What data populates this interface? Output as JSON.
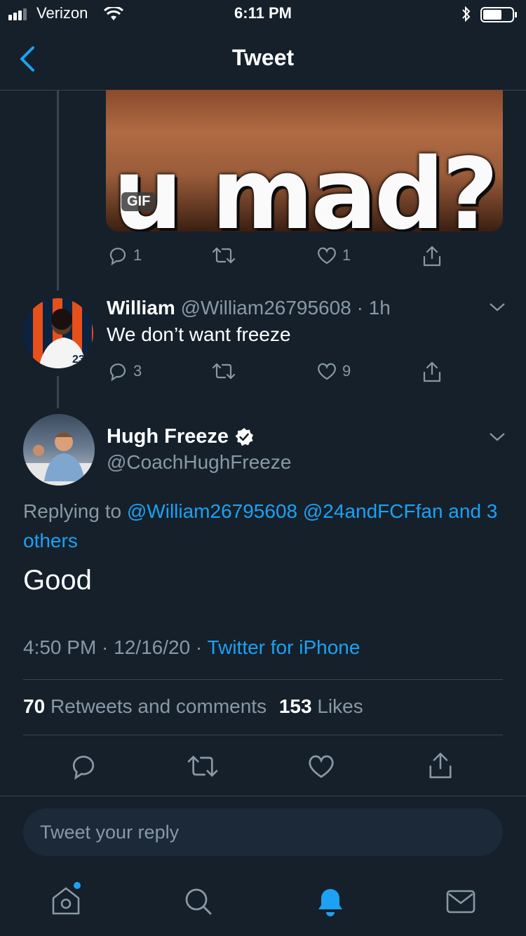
{
  "status_bar": {
    "carrier": "Verizon",
    "time": "6:11 PM"
  },
  "nav": {
    "title": "Tweet"
  },
  "parent_tweet": {
    "gif_text": "u mad?",
    "gif_badge": "GIF",
    "reply_count": "1",
    "like_count": "1"
  },
  "william_tweet": {
    "name": "William",
    "handle": "@William26795608",
    "time": "· 1h",
    "text": "We don’t want freeze",
    "reply_count": "3",
    "like_count": "9"
  },
  "main_tweet": {
    "name": "Hugh Freeze",
    "handle": "@CoachHughFreeze",
    "replying_label": "Replying to",
    "reply_to_1": "@William26795608",
    "reply_to_2": "@24andFCFfan",
    "reply_to_others": "and 3 others",
    "text": "Good",
    "timestamp": "4:50 PM · 12/16/20 ·",
    "source": "Twitter for iPhone",
    "retweet_count": "70",
    "retweet_label": "Retweets and comments",
    "like_count": "153",
    "like_label": "Likes"
  },
  "compose": {
    "placeholder": "Tweet your reply"
  },
  "colors": {
    "background": "#15202b",
    "accent": "#1da1f2",
    "muted": "#8899a6",
    "divider": "#38444d"
  },
  "icons": [
    "back-chevron-icon",
    "reply-icon",
    "retweet-icon",
    "like-icon",
    "share-icon",
    "chevron-down-icon",
    "verified-icon",
    "home-icon",
    "search-icon",
    "notifications-icon",
    "messages-icon",
    "bluetooth-icon",
    "battery-icon",
    "wifi-icon"
  ]
}
